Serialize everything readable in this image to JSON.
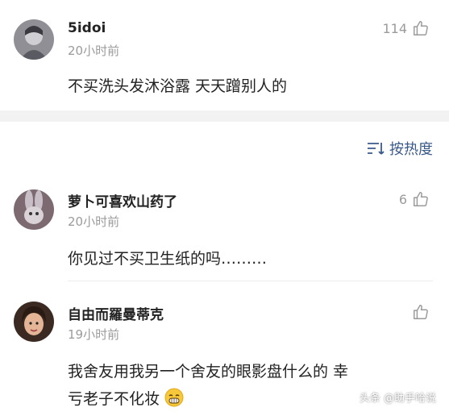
{
  "comments": [
    {
      "name": "5idoi",
      "time": "20小时前",
      "likes": "114",
      "text": "不买洗头发沐浴露 天天蹭别人的"
    },
    {
      "name": "萝卜可喜欢山药了",
      "time": "20小时前",
      "likes": "6",
      "text": "你见过不买卫生纸的吗………"
    },
    {
      "name": "自由而羅曼蒂克",
      "time": "19小时前",
      "likes": "",
      "text_line1": "我舍友用我另一个舍友的眼影盘什么的 幸",
      "text_line2": "亏老子不化妆"
    }
  ],
  "sort": {
    "label": "按热度"
  },
  "watermark": {
    "text": "头条 @助手哈说"
  },
  "colors": {
    "sort_accent": "#3b5a8a",
    "muted": "#9b9b9b",
    "band": "#f2f2f2"
  }
}
